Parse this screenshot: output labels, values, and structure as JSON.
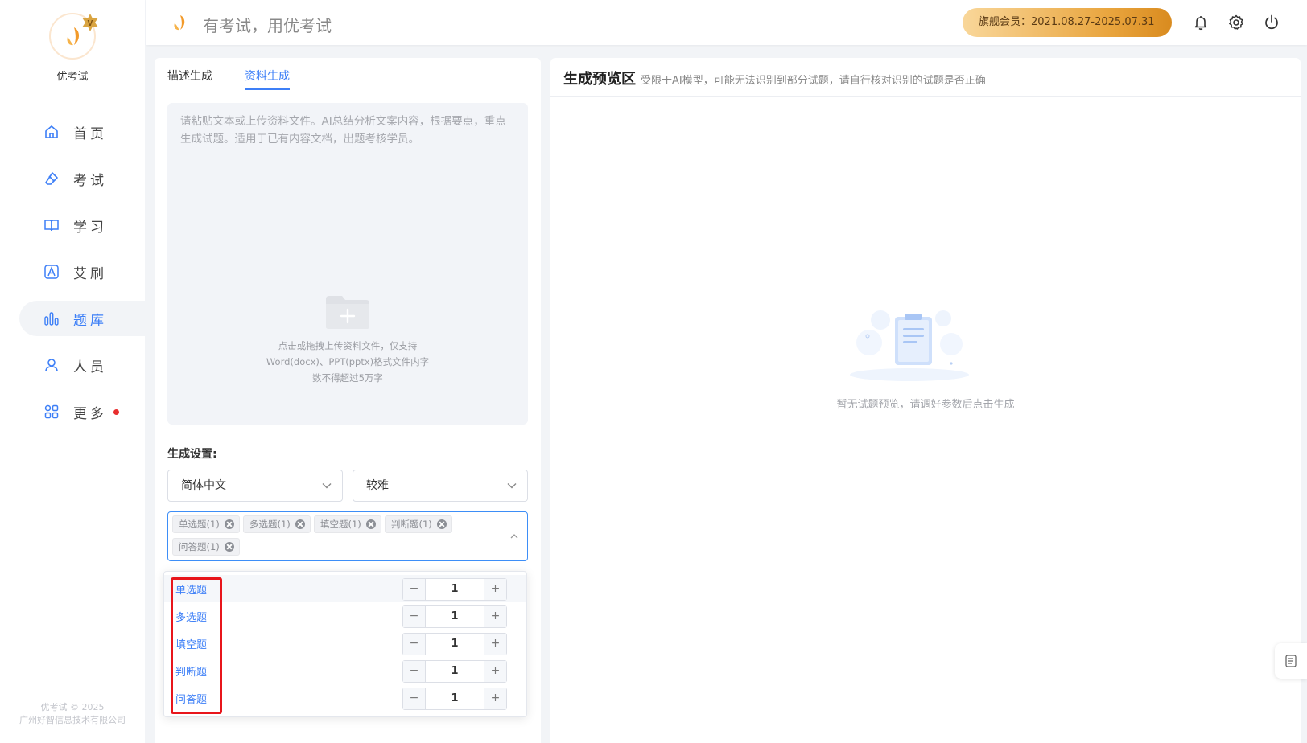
{
  "app": {
    "name": "优考试",
    "slogan": "有考试，用优考试"
  },
  "sidebar": {
    "items": [
      {
        "label": "首页",
        "icon": "home-icon",
        "active": false
      },
      {
        "label": "考试",
        "icon": "eraser-icon",
        "active": false
      },
      {
        "label": "学习",
        "icon": "book-icon",
        "active": false
      },
      {
        "label": "艾刷",
        "icon": "letter-a-icon",
        "active": false
      },
      {
        "label": "题库",
        "icon": "bar-chart-icon",
        "active": true
      },
      {
        "label": "人员",
        "icon": "user-icon",
        "active": false
      },
      {
        "label": "更多",
        "icon": "apps-icon",
        "active": false,
        "dot": true
      }
    ],
    "footer_line1": "优考试 © 2025",
    "footer_line2": "广州好智信息技术有限公司"
  },
  "header": {
    "vip_label": "旗舰会员：2021.08.27-2025.07.31",
    "icons": [
      "bell-icon",
      "gear-icon",
      "power-icon"
    ]
  },
  "left_panel": {
    "tabs": [
      {
        "label": "描述生成",
        "active": false
      },
      {
        "label": "资料生成",
        "active": true
      }
    ],
    "textarea_placeholder": "请粘贴文本或上传资料文件。AI总结分析文案内容，根据要点，重点生成试题。适用于已有内容文档，出题考核学员。",
    "upload_hint_line1": "点击或拖拽上传资料文件，仅支持",
    "upload_hint_line2": "Word(docx)、PPT(pptx)格式文件内字",
    "upload_hint_line3": "数不得超过5万字",
    "settings_label": "生成设置:",
    "language_select": "简体中文",
    "difficulty_select": "较难",
    "selected_tags": [
      "单选题(1)",
      "多选题(1)",
      "填空题(1)",
      "判断题(1)",
      "问答题(1)"
    ]
  },
  "dropdown": {
    "rows": [
      {
        "label": "单选题",
        "value": "1"
      },
      {
        "label": "多选题",
        "value": "1"
      },
      {
        "label": "填空题",
        "value": "1"
      },
      {
        "label": "判断题",
        "value": "1"
      },
      {
        "label": "问答题",
        "value": "1"
      }
    ],
    "minus": "−",
    "plus": "+"
  },
  "preview": {
    "title": "生成预览区",
    "subtitle": "受限于AI模型，可能无法识别到部分试题，请自行核对识别的试题是否正确",
    "empty_text": "暂无试题预览，请调好参数后点击生成"
  },
  "colors": {
    "accent": "#3d7ff7",
    "highlight_box": "#e8151b",
    "brand_orange": "#f0a23a"
  }
}
